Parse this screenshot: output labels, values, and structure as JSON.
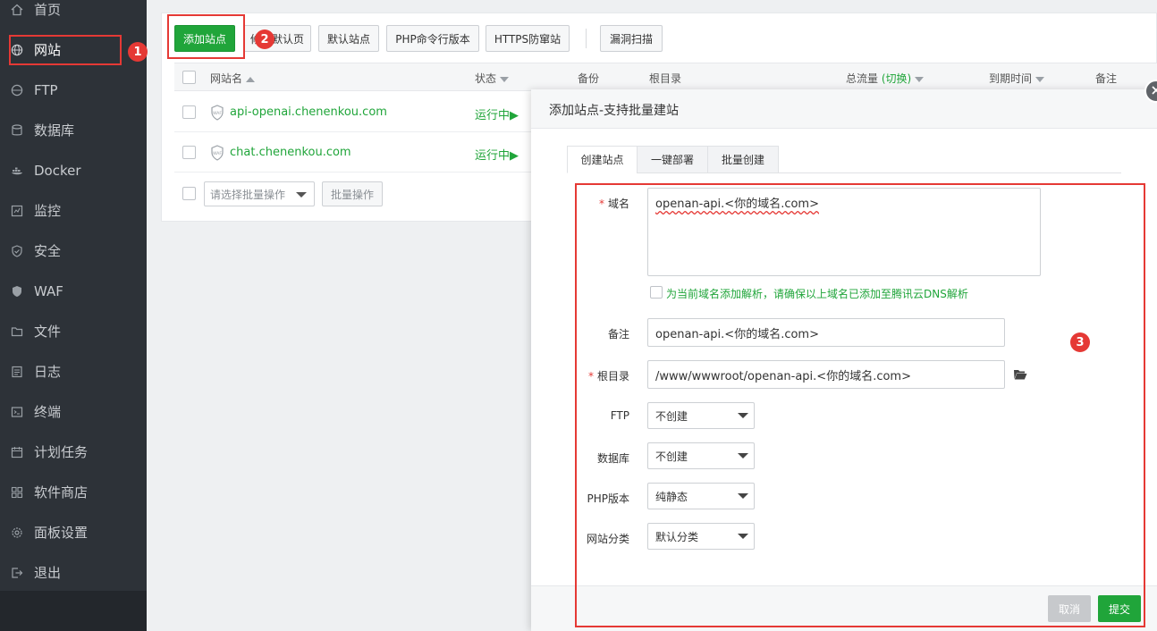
{
  "sidebar": {
    "items": [
      {
        "label": "首页",
        "icon": "home-icon"
      },
      {
        "label": "网站",
        "icon": "globe-icon"
      },
      {
        "label": "FTP",
        "icon": "ftp-globe-icon"
      },
      {
        "label": "数据库",
        "icon": "database-icon"
      },
      {
        "label": "Docker",
        "icon": "docker-icon"
      },
      {
        "label": "监控",
        "icon": "monitor-icon"
      },
      {
        "label": "安全",
        "icon": "shield-icon"
      },
      {
        "label": "WAF",
        "icon": "waf-shield-icon"
      },
      {
        "label": "文件",
        "icon": "folder-icon"
      },
      {
        "label": "日志",
        "icon": "log-icon"
      },
      {
        "label": "终端",
        "icon": "terminal-icon"
      },
      {
        "label": "计划任务",
        "icon": "calendar-icon"
      },
      {
        "label": "软件商店",
        "icon": "grid-icon"
      },
      {
        "label": "面板设置",
        "icon": "gear-icon"
      },
      {
        "label": "退出",
        "icon": "logout-icon"
      }
    ]
  },
  "annotations": {
    "step1": "1",
    "step2": "2",
    "step3": "3",
    "color": "#e53935"
  },
  "toolbar": {
    "add_site": "添加站点",
    "modify_default": "修改默认页",
    "default_site": "默认站点",
    "php_cli": "PHP命令行版本",
    "https_guard": "HTTPS防窜站",
    "vuln_scan": "漏洞扫描"
  },
  "table": {
    "headers": {
      "name": "网站名",
      "status": "状态",
      "backup": "备份",
      "root": "根目录",
      "traffic": "总流量",
      "traffic_switch": "(切换)",
      "expire": "到期时间",
      "note": "备注"
    },
    "rows": [
      {
        "name": "api-openai.chenenkou.com",
        "status": "运行中▶"
      },
      {
        "name": "chat.chenenkou.com",
        "status": "运行中▶"
      }
    ],
    "batch_placeholder": "请选择批量操作",
    "batch_button": "批量操作"
  },
  "modal": {
    "title": "添加站点-支持批量建站",
    "tabs": [
      "创建站点",
      "一键部署",
      "批量创建"
    ],
    "domain_label": "域名",
    "domain_value": "openan-api.<你的域名.com>",
    "dns_hint": "为当前域名添加解析，请确保以上域名已添加至腾讯云DNS解析",
    "note_label": "备注",
    "note_value": "openan-api.<你的域名.com>",
    "root_label": "根目录",
    "root_value": "/www/wwwroot/openan-api.<你的域名.com>",
    "ftp_label": "FTP",
    "ftp_value": "不创建",
    "db_label": "数据库",
    "db_value": "不创建",
    "php_label": "PHP版本",
    "php_value": "纯静态",
    "category_label": "网站分类",
    "category_value": "默认分类",
    "cancel": "取消",
    "submit": "提交"
  },
  "colors": {
    "accent": "#20a53a",
    "sidebar_bg": "#2d3238",
    "highlight": "#e53935"
  }
}
